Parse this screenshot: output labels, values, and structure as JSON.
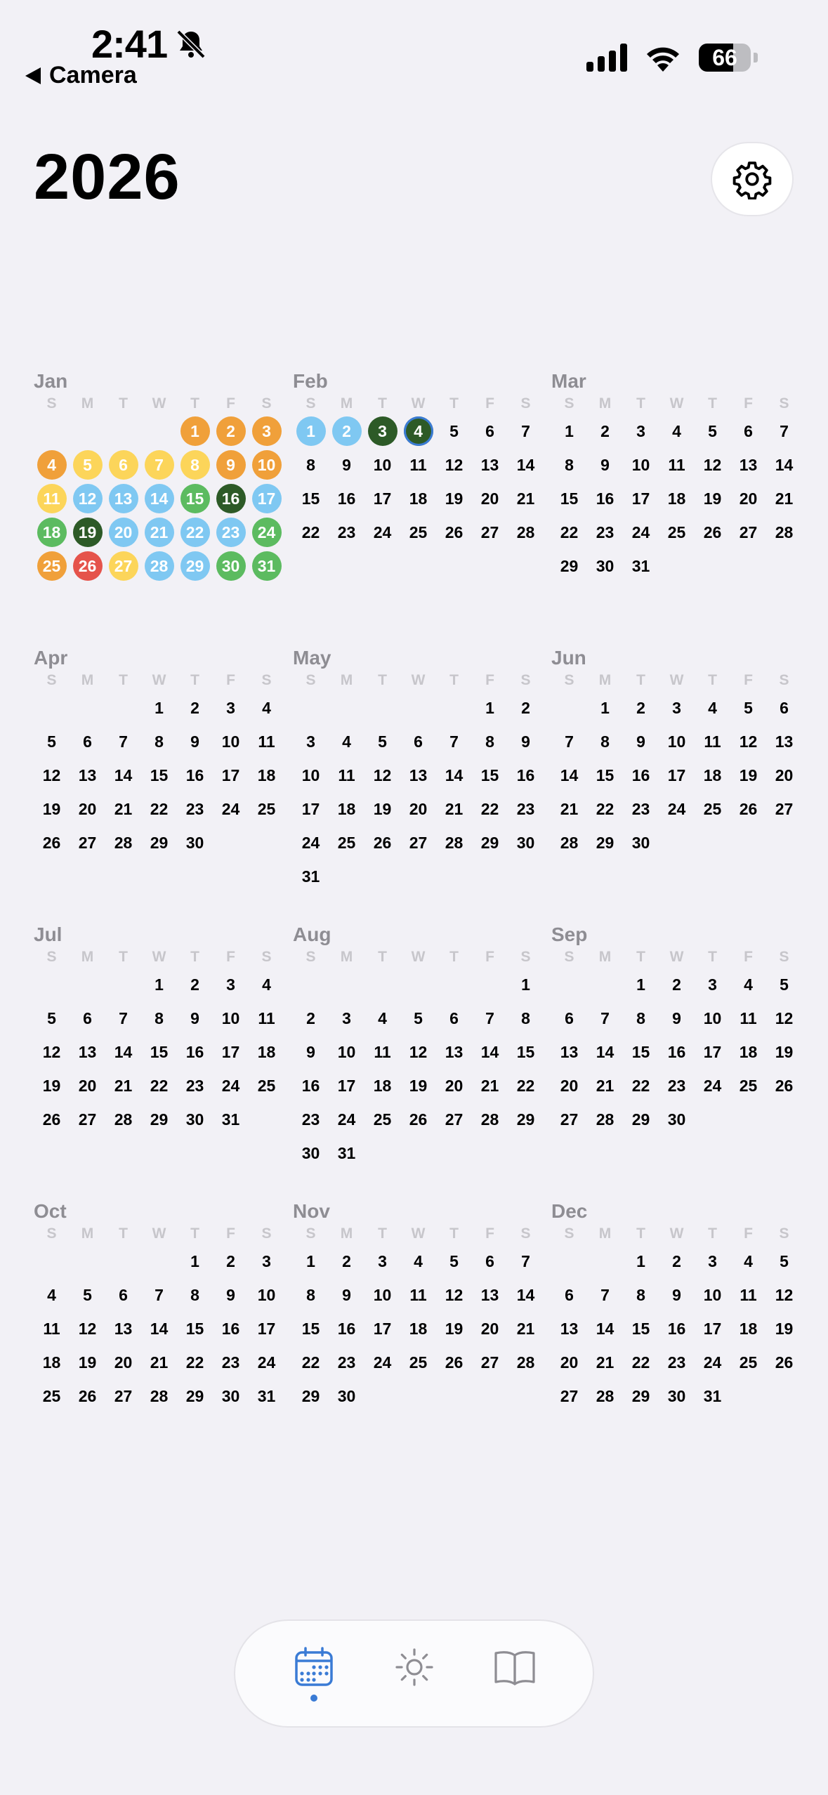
{
  "status": {
    "time": "2:41",
    "back_label": "Camera",
    "battery": "66",
    "battery_level": 0.66
  },
  "header": {
    "year": "2026"
  },
  "weekday_letters": [
    "S",
    "M",
    "T",
    "W",
    "T",
    "F",
    "S"
  ],
  "colors": {
    "orange": "#f0a03a",
    "yellow": "#fcd55a",
    "lightblue": "#7fc8f2",
    "green": "#5cbb60",
    "darkgreen": "#2d5a27",
    "red": "#e5534b",
    "today_ring": "#3a7bd5"
  },
  "months": [
    {
      "name": "Jan",
      "start": 4,
      "days": 31,
      "colored": {
        "1": "orange",
        "2": "orange",
        "3": "orange",
        "4": "orange",
        "5": "yellow",
        "6": "yellow",
        "7": "yellow",
        "8": "yellow",
        "9": "orange",
        "10": "orange",
        "11": "yellow",
        "12": "lightblue",
        "13": "lightblue",
        "14": "lightblue",
        "15": "green",
        "16": "darkgreen",
        "17": "lightblue",
        "18": "green",
        "19": "darkgreen",
        "20": "lightblue",
        "21": "lightblue",
        "22": "lightblue",
        "23": "lightblue",
        "24": "green",
        "25": "orange",
        "26": "red",
        "27": "yellow",
        "28": "lightblue",
        "29": "lightblue",
        "30": "green",
        "31": "green"
      }
    },
    {
      "name": "Feb",
      "start": 0,
      "days": 28,
      "colored": {
        "1": "lightblue",
        "2": "lightblue",
        "3": "darkgreen",
        "4": "darkgreen"
      },
      "today": 4
    },
    {
      "name": "Mar",
      "start": 0,
      "days": 31
    },
    {
      "name": "Apr",
      "start": 3,
      "days": 30
    },
    {
      "name": "May",
      "start": 5,
      "days": 31
    },
    {
      "name": "Jun",
      "start": 1,
      "days": 30
    },
    {
      "name": "Jul",
      "start": 3,
      "days": 31
    },
    {
      "name": "Aug",
      "start": 6,
      "days": 31
    },
    {
      "name": "Sep",
      "start": 2,
      "days": 30
    },
    {
      "name": "Oct",
      "start": 4,
      "days": 31
    },
    {
      "name": "Nov",
      "start": 0,
      "days": 30
    },
    {
      "name": "Dec",
      "start": 2,
      "days": 31
    }
  ],
  "tabs": [
    {
      "name": "calendar",
      "icon": "calendar-icon",
      "active": true
    },
    {
      "name": "sun",
      "icon": "sun-icon",
      "active": false
    },
    {
      "name": "book",
      "icon": "book-icon",
      "active": false
    }
  ]
}
